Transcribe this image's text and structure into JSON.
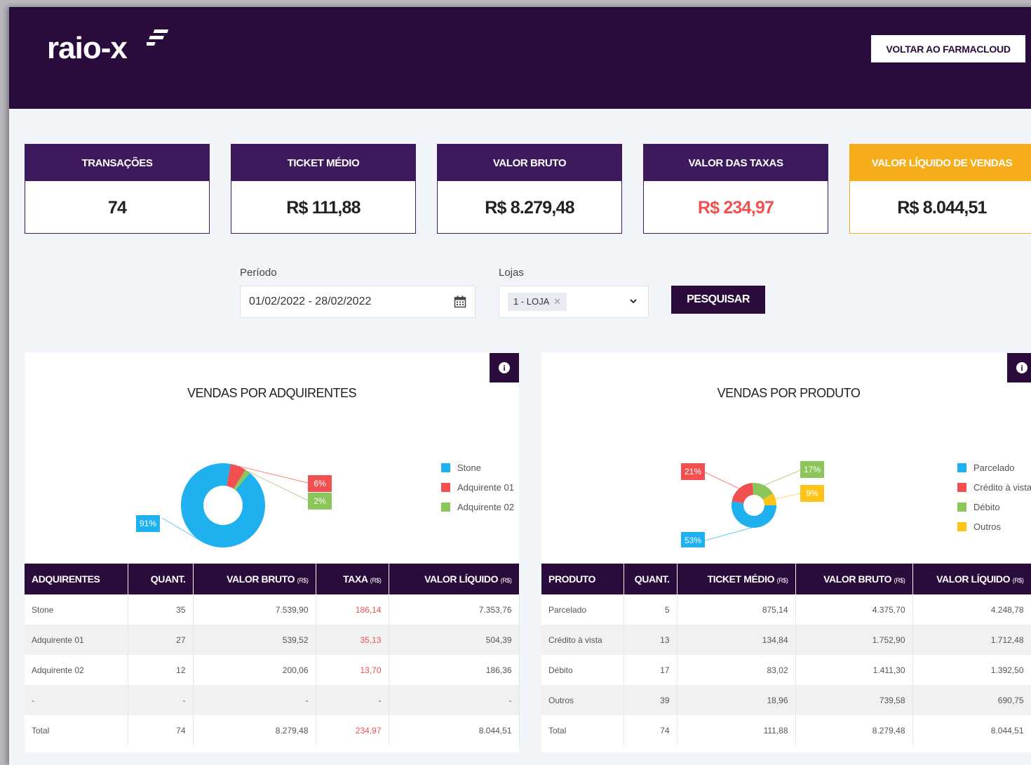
{
  "header": {
    "logo": "raio-x",
    "back_button": "VOLTAR AO FARMACLOUD"
  },
  "kpis": [
    {
      "label": "TRANSAÇÕES",
      "value": "74"
    },
    {
      "label": "TICKET MÉDIO",
      "value": "R$ 111,88"
    },
    {
      "label": "VALOR BRUTO",
      "value": "R$ 8.279,48"
    },
    {
      "label": "VALOR DAS TAXAS",
      "value": "R$ 234,97"
    },
    {
      "label": "VALOR LÍQUIDO DE VENDAS",
      "value": "R$ 8.044,51"
    }
  ],
  "filters": {
    "period_label": "Período",
    "period_value": "01/02/2022 - 28/02/2022",
    "stores_label": "Lojas",
    "store_tag": "1 - LOJA",
    "search_button": "PESQUISAR"
  },
  "colors": {
    "header_bg": "#2a0c3c",
    "card_head": "#3c1a5b",
    "accent_orange": "#f7ad19",
    "tax_red": "#f05050",
    "blue": "#1fb0f0",
    "red": "#f05050",
    "green": "#8cc55a",
    "yellow": "#fcc419"
  },
  "panels": {
    "left": {
      "title": "VENDAS POR ADQUIRENTES",
      "chart_data": {
        "type": "pie",
        "donut": true,
        "categories": [
          "Stone",
          "Adquirente 01",
          "Adquirente 02"
        ],
        "values": [
          91,
          6,
          2
        ],
        "labels": [
          "91%",
          "6%",
          "2%"
        ],
        "colors": [
          "#1fb0f0",
          "#f05050",
          "#8cc55a"
        ],
        "legend": "right"
      },
      "table": {
        "headers": [
          "ADQUIRENTES",
          "QUANT.",
          "VALOR BRUTO",
          "TAXA",
          "VALOR LÍQUIDO"
        ],
        "header_units": [
          "",
          "",
          "(R$)",
          "(R$)",
          "(R$)"
        ],
        "rows": [
          [
            "Stone",
            "35",
            "7.539,90",
            "186,14",
            "7.353,76"
          ],
          [
            "Adquirente 01",
            "27",
            "539,52",
            "35,13",
            "504,39"
          ],
          [
            "Adquirente 02",
            "12",
            "200,06",
            "13,70",
            "186,36"
          ],
          [
            "-",
            "-",
            "-",
            "-",
            "-"
          ],
          [
            "Total",
            "74",
            "8.279,48",
            "234,97",
            "8.044,51"
          ]
        ]
      }
    },
    "right": {
      "title": "VENDAS POR PRODUTO",
      "chart_data": {
        "type": "pie",
        "donut": true,
        "categories": [
          "Parcelado",
          "Crédito à vista",
          "Débito",
          "Outros"
        ],
        "values": [
          53,
          21,
          17,
          9
        ],
        "labels": [
          "53%",
          "21%",
          "17%",
          "9%"
        ],
        "colors": [
          "#1fb0f0",
          "#f05050",
          "#8cc55a",
          "#fcc419"
        ],
        "legend": "right"
      },
      "table": {
        "headers": [
          "PRODUTO",
          "QUANT.",
          "TICKET MÉDIO",
          "VALOR BRUTO",
          "VALOR LÍQUIDO"
        ],
        "header_units": [
          "",
          "",
          "(R$)",
          "(R$)",
          "(R$)"
        ],
        "rows": [
          [
            "Parcelado",
            "5",
            "875,14",
            "4.375,70",
            "4.248,78"
          ],
          [
            "Crédito à vista",
            "13",
            "134,84",
            "1.752,90",
            "1.712,48"
          ],
          [
            "Débito",
            "17",
            "83,02",
            "1.411,30",
            "1.392,50"
          ],
          [
            "Outros",
            "39",
            "18,96",
            "739,58",
            "690,75"
          ],
          [
            "Total",
            "74",
            "111,88",
            "8.279,48",
            "8.044,51"
          ]
        ]
      }
    }
  }
}
